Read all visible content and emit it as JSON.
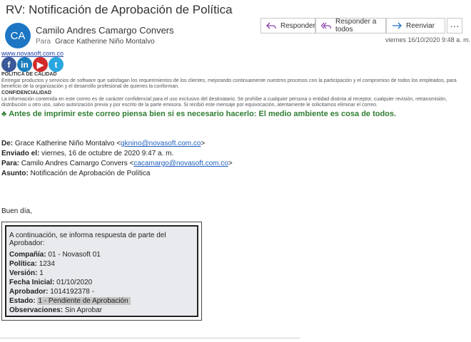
{
  "email": {
    "subject": "RV: Notificación de Aprobación de Política",
    "avatar_initials": "CA",
    "sender_name": "Camilo Andres Camargo Convers",
    "to_label": "Para",
    "to_name": "Grace Katherine Niño Montalvo",
    "date": "viernes 16/10/2020 9:48 a. m."
  },
  "actions": {
    "reply": "Responder",
    "reply_all": "Responder a todos",
    "forward": "Reenviar",
    "more": "···"
  },
  "signature": {
    "site": "www.novasoft.com.co",
    "policy_title": "POLITICA DE CALIDAD",
    "policy_text": "Entregar productos y servicios de software que satisfagan los requerimientos de los clientes, mejorando continuamente nuestros procesos con la participación y el compromiso de todos los empleados, para beneficio de la organización y el desarrollo profesional de quienes la conforman.",
    "conf_title": "CONFIDENCIALIDAD",
    "conf_text": "La información contenida en este correo es de carácter confidencial para el uso exclusivo del destinatario. Se prohíbe a cualquier persona o entidad distinta al receptor, cualquier revisión, retransmisión, distribución u otro uso, salvo autorización previa y por escrito de la parte emisora. Si recibió este mensaje por equivocación, atentamente le solicitamos eliminar el correo.",
    "green_note": "Antes de imprimir este correo piensa bien si es necesario hacerlo: El medio ambiente es cosa de todos."
  },
  "forward_header": {
    "from_label": "De:",
    "from_name": "Grace Katherine Niño Montalvo <",
    "from_email": "gknino@novasoft.com.co",
    "from_end": ">",
    "sent_label": "Enviado el:",
    "sent_value": "viernes, 16 de octubre de 2020 9:47 a. m.",
    "to_label": "Para:",
    "to_name": "Camilo Andres Camargo Convers <",
    "to_email": "cacamargo@novasoft.com.co",
    "to_end": ">",
    "subject_label": "Asunto:",
    "subject_value": "Notificación de Aprobación de Política"
  },
  "body": {
    "greeting": "Buen día,",
    "intro": "A continuación, se informa respuesta de parte del Aprobador:",
    "fields": [
      {
        "label": "Compañía:",
        "value": "01 - Novasoft 01"
      },
      {
        "label": "Política:",
        "value": "1234"
      },
      {
        "label": "Versión:",
        "value": "1"
      },
      {
        "label": "Fecha Inicial:",
        "value": "01/10/2020"
      },
      {
        "label": "Aprobador:",
        "value": "1014192378 -"
      },
      {
        "label": "Estado:",
        "value": "1 - Pendiente de Aprobación"
      },
      {
        "label": "Observaciones:",
        "value": "Sin Aprobar"
      }
    ]
  }
}
